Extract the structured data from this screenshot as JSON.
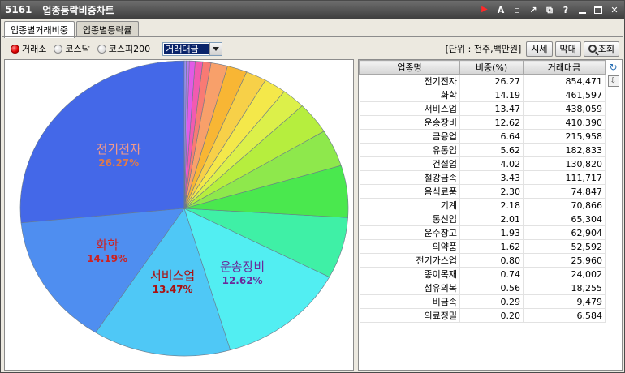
{
  "window": {
    "screen_no": "5161",
    "title": "업종등락비중차트"
  },
  "tabs": [
    {
      "label": "업종별거래비중",
      "active": true
    },
    {
      "label": "업종별등락률",
      "active": false
    }
  ],
  "toolbar": {
    "markets": [
      {
        "label": "거래소",
        "selected": true
      },
      {
        "label": "코스닥",
        "selected": false
      },
      {
        "label": "코스피200",
        "selected": false
      }
    ],
    "metric_select": "거래대금",
    "unit_label": "[단위 : 천주,백만원]",
    "btn_market_cap": "시세",
    "btn_bar": "막대",
    "btn_search": "조회"
  },
  "grid": {
    "columns": [
      "업종명",
      "비중(%)",
      "거래대금"
    ],
    "rows": [
      [
        "전기전자",
        "26.27",
        "854,471"
      ],
      [
        "화학",
        "14.19",
        "461,597"
      ],
      [
        "서비스업",
        "13.47",
        "438,059"
      ],
      [
        "운송장비",
        "12.62",
        "410,390"
      ],
      [
        "금융업",
        "6.64",
        "215,958"
      ],
      [
        "유통업",
        "5.62",
        "182,833"
      ],
      [
        "건설업",
        "4.02",
        "130,820"
      ],
      [
        "철강금속",
        "3.43",
        "111,717"
      ],
      [
        "음식료품",
        "2.30",
        "74,847"
      ],
      [
        "기계",
        "2.18",
        "70,866"
      ],
      [
        "통신업",
        "2.01",
        "65,304"
      ],
      [
        "운수창고",
        "1.93",
        "62,904"
      ],
      [
        "의약품",
        "1.62",
        "52,592"
      ],
      [
        "전기가스업",
        "0.80",
        "25,960"
      ],
      [
        "종이목재",
        "0.74",
        "24,002"
      ],
      [
        "섬유의복",
        "0.56",
        "18,255"
      ],
      [
        "비금속",
        "0.29",
        "9,479"
      ],
      [
        "의료정밀",
        "0.20",
        "6,584"
      ]
    ]
  },
  "chart_data": {
    "type": "pie",
    "title": "",
    "categories": [
      "전기전자",
      "화학",
      "서비스업",
      "운송장비",
      "금융업",
      "유통업",
      "건설업",
      "철강금속",
      "음식료품",
      "기계",
      "통신업",
      "운수창고",
      "의약품",
      "전기가스업",
      "종이목재",
      "섬유의복",
      "비금속",
      "의료정밀"
    ],
    "values": [
      26.27,
      14.19,
      13.47,
      12.62,
      6.64,
      5.62,
      4.02,
      3.43,
      2.3,
      2.18,
      2.01,
      1.93,
      1.62,
      0.8,
      0.74,
      0.56,
      0.29,
      0.2
    ],
    "colors": [
      "#4468e8",
      "#4f8ef0",
      "#4fc8f6",
      "#52eef2",
      "#3ff0a6",
      "#4ae84e",
      "#8ee84c",
      "#b6ee3e",
      "#dcf04a",
      "#f4e84a",
      "#f7d048",
      "#f8b634",
      "#f8a06a",
      "#f87a74",
      "#f25ab0",
      "#e25ae6",
      "#b87af2",
      "#9a8ef4"
    ],
    "labels": [
      {
        "name": "전기전자",
        "pct": "26.27%",
        "name_color": "#f29a8a",
        "pct_color": "#e07a4a"
      },
      {
        "name": "화학",
        "pct": "14.19%",
        "name_color": "#cc2222",
        "pct_color": "#cc2222"
      },
      {
        "name": "서비스업",
        "pct": "13.47%",
        "name_color": "#aa1111",
        "pct_color": "#aa1111"
      },
      {
        "name": "운송장비",
        "pct": "12.62%",
        "name_color": "#6a2a9a",
        "pct_color": "#6a2a9a"
      }
    ]
  }
}
